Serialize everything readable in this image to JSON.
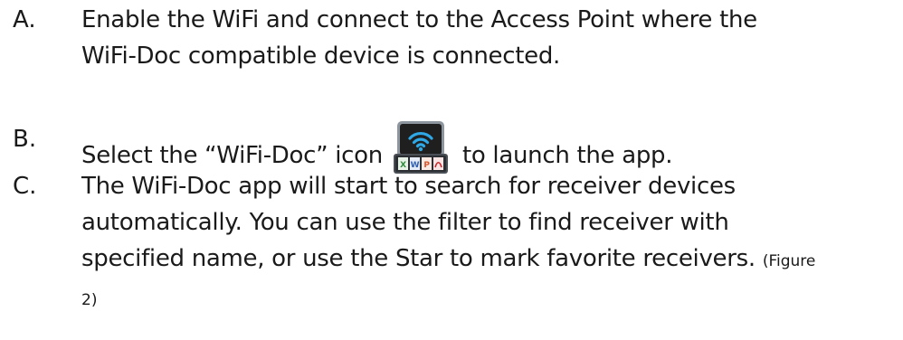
{
  "steps": [
    {
      "marker": "A.",
      "lines": [
        "Enable the WiFi and connect to the Access Point where the",
        "WiFi-Doc compatible device is connected."
      ]
    },
    {
      "marker": "B.",
      "text_before_icon": "Select the “WiFi-Doc” icon",
      "icon": "wifi-doc-app-icon",
      "text_after_icon": "to launch the app."
    },
    {
      "marker": "C.",
      "lines": [
        "The WiFi-Doc app will start to search for receiver devices",
        "automatically. You can use the filter to find receiver with",
        "specified name, or use the Star to mark favorite receivers."
      ],
      "figure_ref_part1": "(Figure",
      "figure_ref_part2": "2)"
    }
  ],
  "icon_colors": {
    "screen": "#1f1f1f",
    "frame": "#9aa3ab",
    "wifi": "#2ea8e6",
    "doc_x": "#2e8b3d",
    "doc_w": "#2f5fb3",
    "doc_p": "#d9542b",
    "doc_pdf": "#c8262b"
  }
}
